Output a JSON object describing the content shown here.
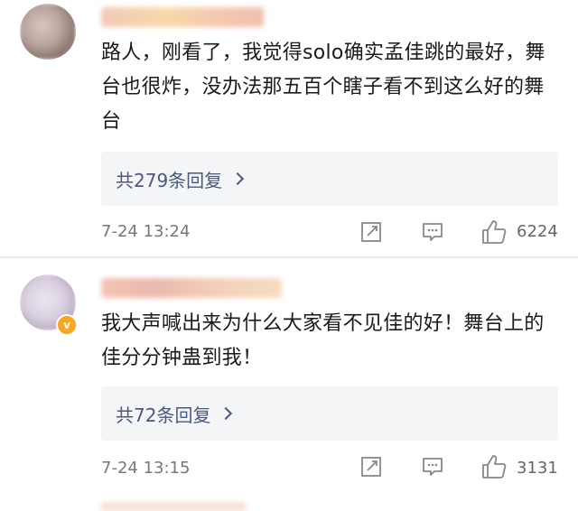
{
  "comments": [
    {
      "text": "路人，刚看了，我觉得solo确实孟佳跳的最好，舞台也很炸，没办法那五百个瞎子看不到这么好的舞台",
      "reply_label": "共279条回复",
      "timestamp": "7-24 13:24",
      "likes": "6224",
      "has_vip_badge": false
    },
    {
      "text": "我大声喊出来为什么大家看不见佳的好！舞台上的佳分分钟蛊到我！",
      "reply_label": "共72条回复",
      "timestamp": "7-24 13:15",
      "likes": "3131",
      "has_vip_badge": true,
      "badge_letter": "v"
    }
  ],
  "icons": {
    "share": "share-edit-icon",
    "comment": "comment-bubble-icon",
    "like": "thumbs-up-icon",
    "chevron": "chevron-right-icon"
  },
  "colors": {
    "reply_text": "#4a5a7a",
    "reply_bg": "#f4f5f7",
    "meta_text": "#777777",
    "vip_badge": "#f5a623"
  }
}
